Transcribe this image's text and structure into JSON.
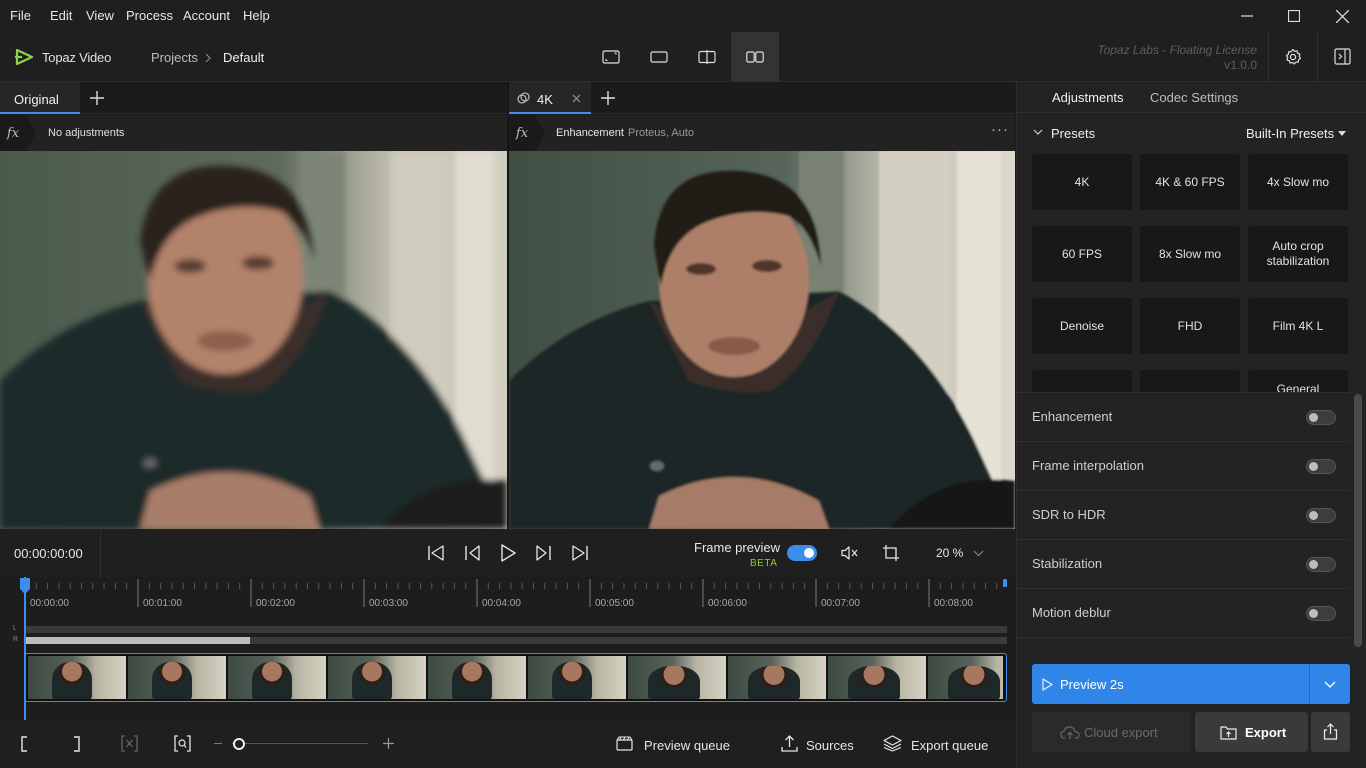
{
  "menu": {
    "items": [
      "File",
      "Edit",
      "View",
      "Process",
      "Account",
      "Help"
    ]
  },
  "header": {
    "app_name": "Topaz Video",
    "breadcrumb_root": "Projects",
    "breadcrumb_current": "Default",
    "license_text": "Topaz Labs - Floating License",
    "version": "v1.0.0"
  },
  "left_pane": {
    "tab_label": "Original",
    "fx_label": "No adjustments"
  },
  "right_pane": {
    "tab_label": "4K",
    "fx_title": "Enhancement",
    "fx_detail": "Proteus, Auto"
  },
  "panel": {
    "tabs": [
      "Adjustments",
      "Codec Settings"
    ],
    "presets_label": "Presets",
    "presets_source": "Built-In Presets",
    "presets": [
      "4K",
      "4K & 60 FPS",
      "4x Slow mo",
      "60 FPS",
      "8x Slow mo",
      "Auto crop stabilization",
      "Denoise",
      "FHD",
      "Film 4K L",
      "",
      "",
      "General"
    ],
    "toggles": [
      {
        "label": "Enhancement",
        "on": false
      },
      {
        "label": "Frame interpolation",
        "on": false
      },
      {
        "label": "SDR to HDR",
        "on": false
      },
      {
        "label": "Stabilization",
        "on": false
      },
      {
        "label": "Motion deblur",
        "on": false
      }
    ],
    "preview_label": "Preview 2s",
    "cloud_export_label": "Cloud export",
    "export_label": "Export"
  },
  "transport": {
    "timecode": "00:00:00:00",
    "frame_preview_label": "Frame preview",
    "frame_preview_on": true,
    "beta_label": "BETA",
    "zoom": "20 %"
  },
  "timeline": {
    "ticks": [
      "00:00:00",
      "00:01:00",
      "00:02:00",
      "00:03:00",
      "00:04:00",
      "00:05:00",
      "00:06:00",
      "00:07:00",
      "00:08:00"
    ],
    "track_l": "L",
    "track_r": "R",
    "zoom_fraction": 0.0
  },
  "bottombar": {
    "preview_queue": "Preview queue",
    "sources": "Sources",
    "export_queue": "Export queue"
  },
  "colors": {
    "accent": "#3c8df0",
    "preview_button": "#2f86e8",
    "beta": "#8fcf2f",
    "logo": "#8fd14f"
  }
}
